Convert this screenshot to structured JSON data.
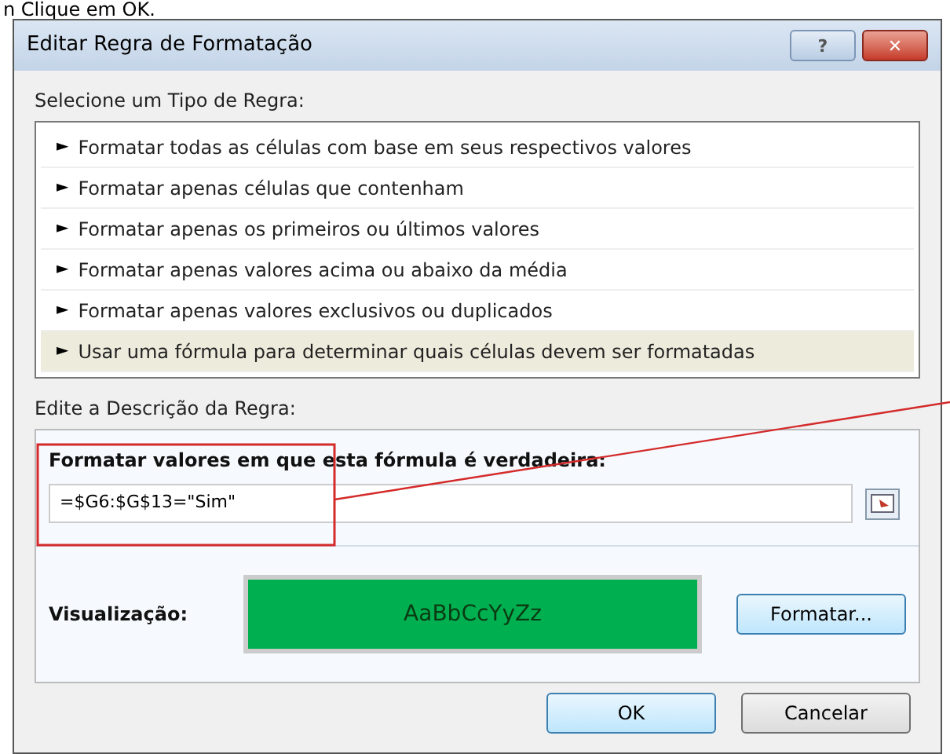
{
  "caption": "n Clique em OK.",
  "window": {
    "title": "Editar Regra de Formatação",
    "buttons": [
      {
        "kind": "help",
        "label": "?"
      },
      {
        "kind": "close",
        "label": "✕"
      }
    ]
  },
  "rule_type": {
    "label": "Selecione um Tipo de Regra:",
    "items": [
      {
        "marker": "►",
        "label": "Formatar todas as células com base em seus respectivos valores",
        "selected": false
      },
      {
        "marker": "►",
        "label": "Formatar apenas células que contenham",
        "selected": false
      },
      {
        "marker": "►",
        "label": "Formatar apenas os primeiros ou últimos valores",
        "selected": false
      },
      {
        "marker": "►",
        "label": "Formatar apenas valores acima ou abaixo da média",
        "selected": false
      },
      {
        "marker": "►",
        "label": "Formatar apenas valores exclusivos ou duplicados",
        "selected": false
      },
      {
        "marker": "►",
        "label": "Usar uma fórmula para determinar quais células devem ser formatadas",
        "selected": true
      }
    ]
  },
  "description": {
    "label": "Edite a Descrição da Regra:",
    "formula_label": "Formatar valores em que esta fórmula é verdadeira:",
    "formula": "=$G6:$G$13=\"Sim\"",
    "preview_label": "Visualização:",
    "preview_text": "AaBbCcYyZz",
    "format_button": "Formatar..."
  },
  "buttons": [
    "OK",
    "Cancelar"
  ]
}
